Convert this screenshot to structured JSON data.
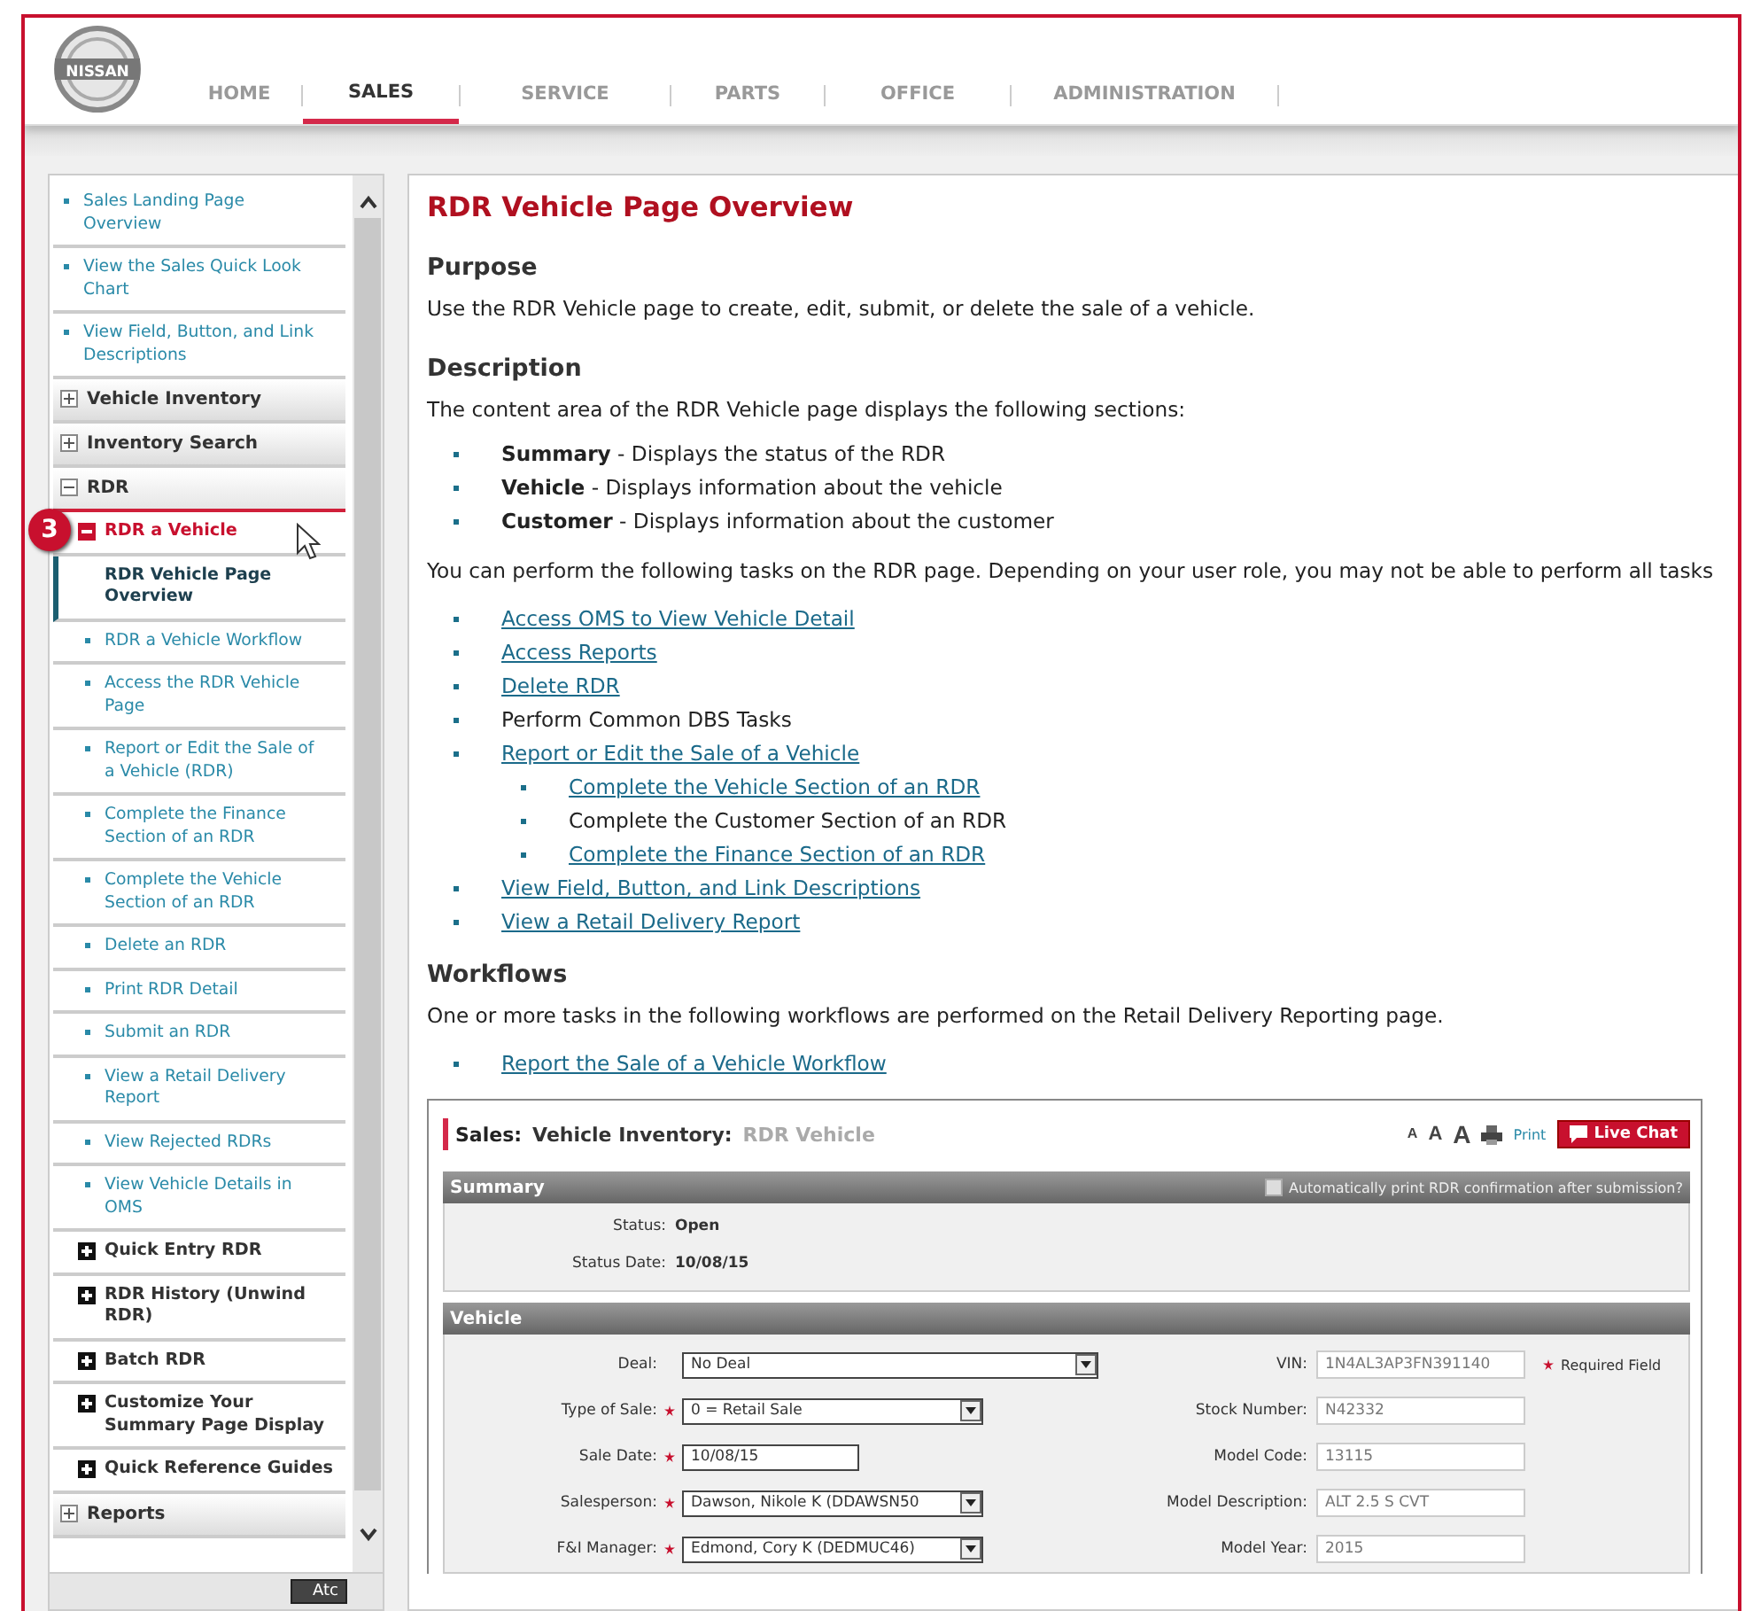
{
  "header": {
    "logo_text": "NISSAN",
    "tabs": [
      {
        "label": "HOME",
        "selected": false
      },
      {
        "label": "SALES",
        "selected": true
      },
      {
        "label": "SERVICE",
        "selected": false
      },
      {
        "label": "PARTS",
        "selected": false
      },
      {
        "label": "OFFICE",
        "selected": false
      },
      {
        "label": "ADMINISTRATION",
        "selected": false
      }
    ]
  },
  "sidebar": {
    "items": [
      {
        "kind": "link",
        "label": "Sales Landing Page Overview",
        "selected": false
      },
      {
        "kind": "link",
        "label": "View the Sales Quick Look Chart",
        "selected": false
      },
      {
        "kind": "link",
        "label": "View Field, Button, and Link Descriptions",
        "selected": false
      },
      {
        "kind": "section",
        "label": "Vehicle Inventory",
        "expanded": false
      },
      {
        "kind": "section",
        "label": "Inventory Search",
        "expanded": false
      },
      {
        "kind": "section",
        "label": "RDR",
        "expanded": true,
        "children": [
          {
            "kind": "group",
            "label": "RDR a Vehicle",
            "expanded": true,
            "callout": "3",
            "children": [
              {
                "kind": "link",
                "label": "RDR Vehicle Page Overview",
                "selected": true
              },
              {
                "kind": "link",
                "label": "RDR a Vehicle Workflow",
                "selected": false
              },
              {
                "kind": "link",
                "label": "Access the RDR Vehicle Page",
                "selected": false
              },
              {
                "kind": "link",
                "label": "Report or Edit the Sale of a Vehicle (RDR)",
                "selected": false
              },
              {
                "kind": "link",
                "label": "Complete the Finance Section of an RDR",
                "selected": false
              },
              {
                "kind": "link",
                "label": "Complete the Vehicle Section of an RDR",
                "selected": false
              },
              {
                "kind": "link",
                "label": "Delete an RDR",
                "selected": false
              },
              {
                "kind": "link",
                "label": "Print RDR Detail",
                "selected": false
              },
              {
                "kind": "link",
                "label": "Submit an RDR",
                "selected": false
              },
              {
                "kind": "link",
                "label": "View a Retail Delivery Report",
                "selected": false
              },
              {
                "kind": "link",
                "label": "View Rejected RDRs",
                "selected": false
              },
              {
                "kind": "link",
                "label": "View Vehicle Details in OMS",
                "selected": false
              }
            ]
          },
          {
            "kind": "group",
            "label": "Quick Entry RDR",
            "expanded": false
          },
          {
            "kind": "group",
            "label": "RDR History (Unwind RDR)",
            "expanded": false
          },
          {
            "kind": "group",
            "label": "Batch RDR",
            "expanded": false
          },
          {
            "kind": "group",
            "label": "Customize Your Summary Page Display",
            "expanded": false
          },
          {
            "kind": "group",
            "label": "Quick Reference Guides",
            "expanded": false
          }
        ]
      },
      {
        "kind": "section",
        "label": "Reports",
        "expanded": false
      }
    ],
    "footer_button": "Atc"
  },
  "content": {
    "title": "RDR Vehicle Page Overview",
    "sections": [
      {
        "kind": "text",
        "heading": "Purpose",
        "paragraphs": [
          "Use the RDR Vehicle page to create, edit, submit, or delete the sale of a vehicle."
        ]
      },
      {
        "kind": "description",
        "heading": "Description",
        "intro": "The content area of the RDR Vehicle page displays the following sections:",
        "bullets": [
          "**Summary** - Displays the status of the RDR",
          "**Vehicle** - Displays information about the vehicle",
          "**Customer** - Displays information about the customer"
        ],
        "tasks_intro": "You can perform the following tasks on the RDR page. Depending on your user role, you may not be able to perform all tasks",
        "tasks": [
          {
            "kind": "link",
            "label": "Access OMS to View Vehicle Detail"
          },
          {
            "kind": "link",
            "label": "Access Reports"
          },
          {
            "kind": "link",
            "label": "Delete RDR"
          },
          {
            "kind": "text",
            "label": "Perform Common DBS Tasks"
          },
          {
            "kind": "link",
            "label": "Report or Edit the Sale of a Vehicle",
            "children": [
              {
                "kind": "link",
                "label": "Complete the Vehicle Section of an RDR"
              },
              {
                "kind": "text",
                "label": "Complete the Customer Section of an RDR"
              },
              {
                "kind": "link",
                "label": "Complete the Finance Section of an RDR"
              }
            ]
          },
          {
            "kind": "link",
            "label": "View Field, Button, and Link Descriptions"
          },
          {
            "kind": "link",
            "label": "View a Retail Delivery Report"
          }
        ]
      },
      {
        "kind": "workflows",
        "heading": "Workflows",
        "intro": "One or more tasks in the following workflows are performed on the Retail Delivery Reporting page.",
        "links": [
          "Report the Sale of a Vehicle Workflow"
        ]
      }
    ]
  },
  "rdr_screen": {
    "breadcrumb": [
      {
        "kind": "root",
        "label": "Sales:"
      },
      {
        "kind": "parent",
        "label": "Vehicle Inventory:"
      },
      {
        "kind": "current",
        "label": "RDR Vehicle"
      }
    ],
    "font_sizes": [
      "A",
      "A",
      "A"
    ],
    "print": "Print",
    "live_chat": "Live Chat",
    "summary": {
      "title": "Summary",
      "auto_print": {
        "label": "Automatically print RDR confirmation after submission?",
        "checked": false
      },
      "fields": [
        {
          "label": "Status:",
          "value": "Open"
        },
        {
          "label": "Status Date:",
          "value": "10/08/15"
        }
      ]
    },
    "vehicle": {
      "title": "Vehicle",
      "required_legend": "Required Field",
      "left_fields": [
        {
          "label": "Deal:",
          "required": false,
          "kind": "select",
          "value": "No Deal"
        },
        {
          "label": "Type of Sale:",
          "required": true,
          "kind": "select",
          "value": "0 = Retail Sale"
        },
        {
          "label": "Sale Date:",
          "required": true,
          "kind": "input",
          "value": "10/08/15"
        },
        {
          "label": "Salesperson:",
          "required": true,
          "kind": "select",
          "value": "Dawson, Nikole K (DDAWSN50"
        },
        {
          "label": "F&I Manager:",
          "required": true,
          "kind": "select",
          "value": "Edmond, Cory K (DEDMUC46)"
        }
      ],
      "right_fields": [
        {
          "label": "VIN:",
          "value": "1N4AL3AP3FN391140"
        },
        {
          "label": "Stock Number:",
          "value": "N42332"
        },
        {
          "label": "Model Code:",
          "value": "13115"
        },
        {
          "label": "Model Description:",
          "value": "ALT 2.5 S CVT"
        },
        {
          "label": "Model Year:",
          "value": "2015"
        }
      ]
    }
  }
}
